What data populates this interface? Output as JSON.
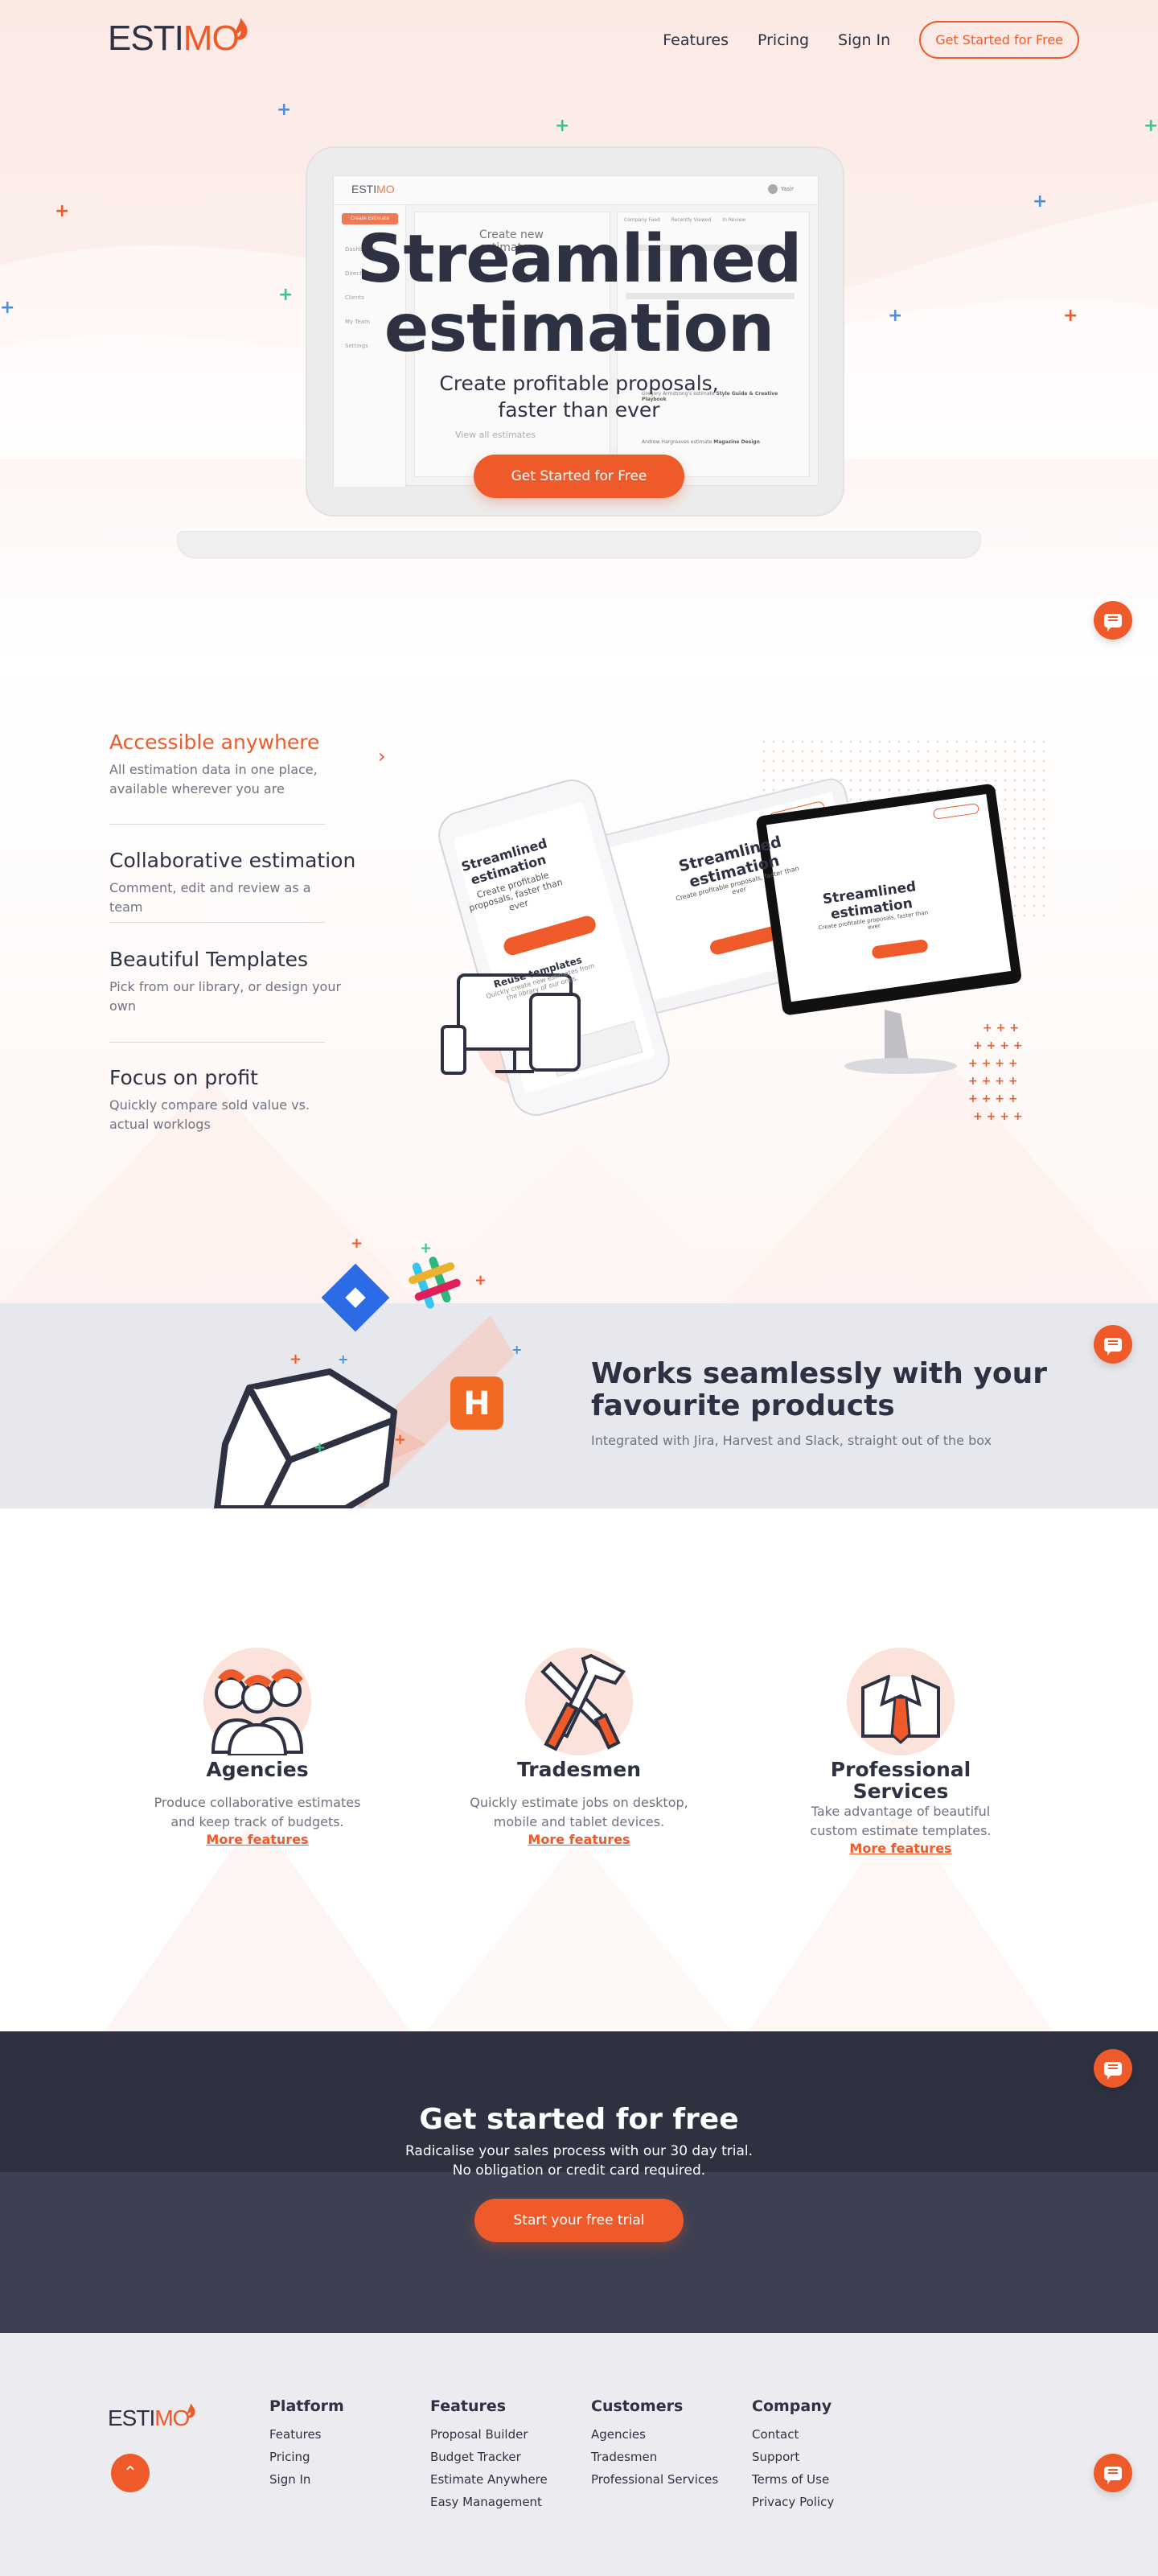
{
  "brand": {
    "logo_main": "ESTI",
    "logo_accent": "MO",
    "accent_color": "#ef5a2a",
    "dark_color": "#2d3142"
  },
  "nav": {
    "links": [
      "Features",
      "Pricing",
      "Sign In"
    ],
    "cta": "Get Started for Free"
  },
  "hero": {
    "title_line1": "Streamlined",
    "title_line2": "estimation",
    "subtitle_line1": "Create profitable proposals,",
    "subtitle_line2": "faster than ever",
    "cta": "Get Started for Free",
    "mock": {
      "logo_main": "ESTI",
      "logo_accent": "MO",
      "create_btn": "Create Estimate",
      "sidebar_items": [
        "Dashboard",
        "Directory",
        "Clients",
        "My Team",
        "Settings"
      ],
      "card_title": "Create new estimate",
      "view_all": "View all estimates",
      "tabs": [
        "Company Feed",
        "Recently Viewed",
        "In Review"
      ],
      "user": "Yasir",
      "feed": [
        {
          "name": "Gregory Armstrong's",
          "action": "estimate",
          "item": "Style Guide & Creative Playbook"
        },
        {
          "name": "Andrew Hargreaves",
          "action": "estimate",
          "item": "Magazine Design"
        }
      ]
    }
  },
  "features": [
    {
      "title": "Accessible anywhere",
      "desc": "All estimation data in one place, available wherever you are",
      "active": true
    },
    {
      "title": "Collaborative estimation",
      "desc": "Comment, edit and review as a team",
      "active": false
    },
    {
      "title": "Beautiful Templates",
      "desc": "Pick from our library, or design your own",
      "active": false
    },
    {
      "title": "Focus on profit",
      "desc": "Quickly compare sold value vs. actual worklogs",
      "active": false
    }
  ],
  "devices": {
    "phone_title_line1": "Streamlined",
    "phone_title_line2": "estimation",
    "phone_sub": "Create profitable proposals, faster than ever",
    "phone_cta": "Get Started for Free",
    "phone_section": "Reuse templates",
    "phone_section_sub": "Quickly create new estimates from the library of our ones.",
    "tablet_title_line1": "Streamlined",
    "tablet_title_line2": "estimation",
    "tablet_sub": "Create profitable proposals, faster than ever",
    "tablet_cta": "Get Started for Free",
    "monitor_title_line1": "Streamlined",
    "monitor_title_line2": "estimation",
    "monitor_sub": "Create profitable proposals, faster than ever",
    "monitor_cta": "Get Started for Free"
  },
  "integrations": {
    "title_line1": "Works seamlessly with your",
    "title_line2": "favourite products",
    "subtitle": "Integrated with Jira, Harvest and Slack, straight out of the box",
    "harvest_letter": "H"
  },
  "audiences": [
    {
      "title": "Agencies",
      "desc_line1": "Produce collaborative estimates",
      "desc_line2": "and keep track of budgets.",
      "link": "More features"
    },
    {
      "title": "Tradesmen",
      "desc_line1": "Quickly estimate jobs on desktop,",
      "desc_line2": "mobile and tablet devices.",
      "link": "More features"
    },
    {
      "title_line1": "Professional",
      "title_line2": "Services",
      "desc_line1": "Take advantage of beautiful",
      "desc_line2": "custom estimate templates.",
      "link": "More features"
    }
  ],
  "cta": {
    "title": "Get started for free",
    "line1": "Radicalise your sales process with our 30 day trial.",
    "line2": "No obligation or credit card required.",
    "button": "Start your free trial"
  },
  "footer": {
    "columns": [
      {
        "heading": "Platform",
        "links": [
          "Features",
          "Pricing",
          "Sign In"
        ]
      },
      {
        "heading": "Features",
        "links": [
          "Proposal Builder",
          "Budget Tracker",
          "Estimate Anywhere",
          "Easy Management"
        ]
      },
      {
        "heading": "Customers",
        "links": [
          "Agencies",
          "Tradesmen",
          "Professional Services"
        ]
      },
      {
        "heading": "Company",
        "links": [
          "Contact",
          "Support",
          "Terms of Use",
          "Privacy Policy"
        ]
      }
    ]
  },
  "icons": {
    "chat": "chat-bubble-icon",
    "scroll_down": "arrow-down-icon",
    "back_to_top": "arrow-up-icon",
    "feature_chevron": "chevron-right-icon"
  }
}
